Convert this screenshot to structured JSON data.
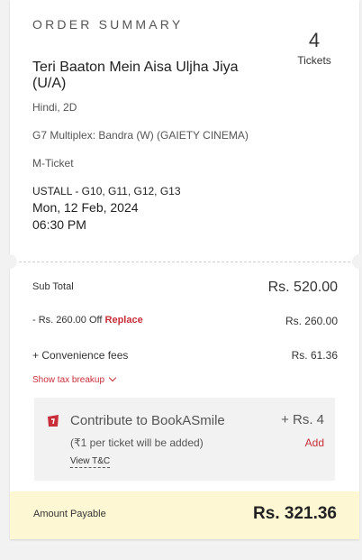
{
  "summary": {
    "title": "ORDER SUMMARY",
    "ticket_count": "4",
    "ticket_label": "Tickets",
    "movie_title": "Teri Baaton Mein Aisa Uljha Jiya (U/A)",
    "language_format": "Hindi, 2D",
    "venue": "G7 Multiplex: Bandra (W) (GAIETY CINEMA)",
    "ticket_type": "M-Ticket",
    "seats": "USTALL - G10, G11, G12, G13",
    "date": "Mon, 12 Feb, 2024",
    "time": "06:30 PM"
  },
  "pricing": {
    "subtotal_label": "Sub Total",
    "subtotal_value": "Rs. 520.00",
    "discount_label": "- Rs. 260.00 Off",
    "replace_label": "Replace",
    "discount_value": "Rs. 260.00",
    "convenience_label": "+ Convenience fees",
    "convenience_value": "Rs. 61.36",
    "tax_breakup_label": "Show tax breakup"
  },
  "contribution": {
    "title": "Contribute to BookASmile",
    "amount": "+ Rs. 4",
    "subtitle": "(₹1 per ticket will be added)",
    "add_label": "Add",
    "tc_label": "View T&C"
  },
  "payable": {
    "label": "Amount Payable",
    "value": "Rs. 321.36"
  },
  "colors": {
    "accent": "#c82f3b",
    "payable_bg": "#fdf8d3"
  }
}
